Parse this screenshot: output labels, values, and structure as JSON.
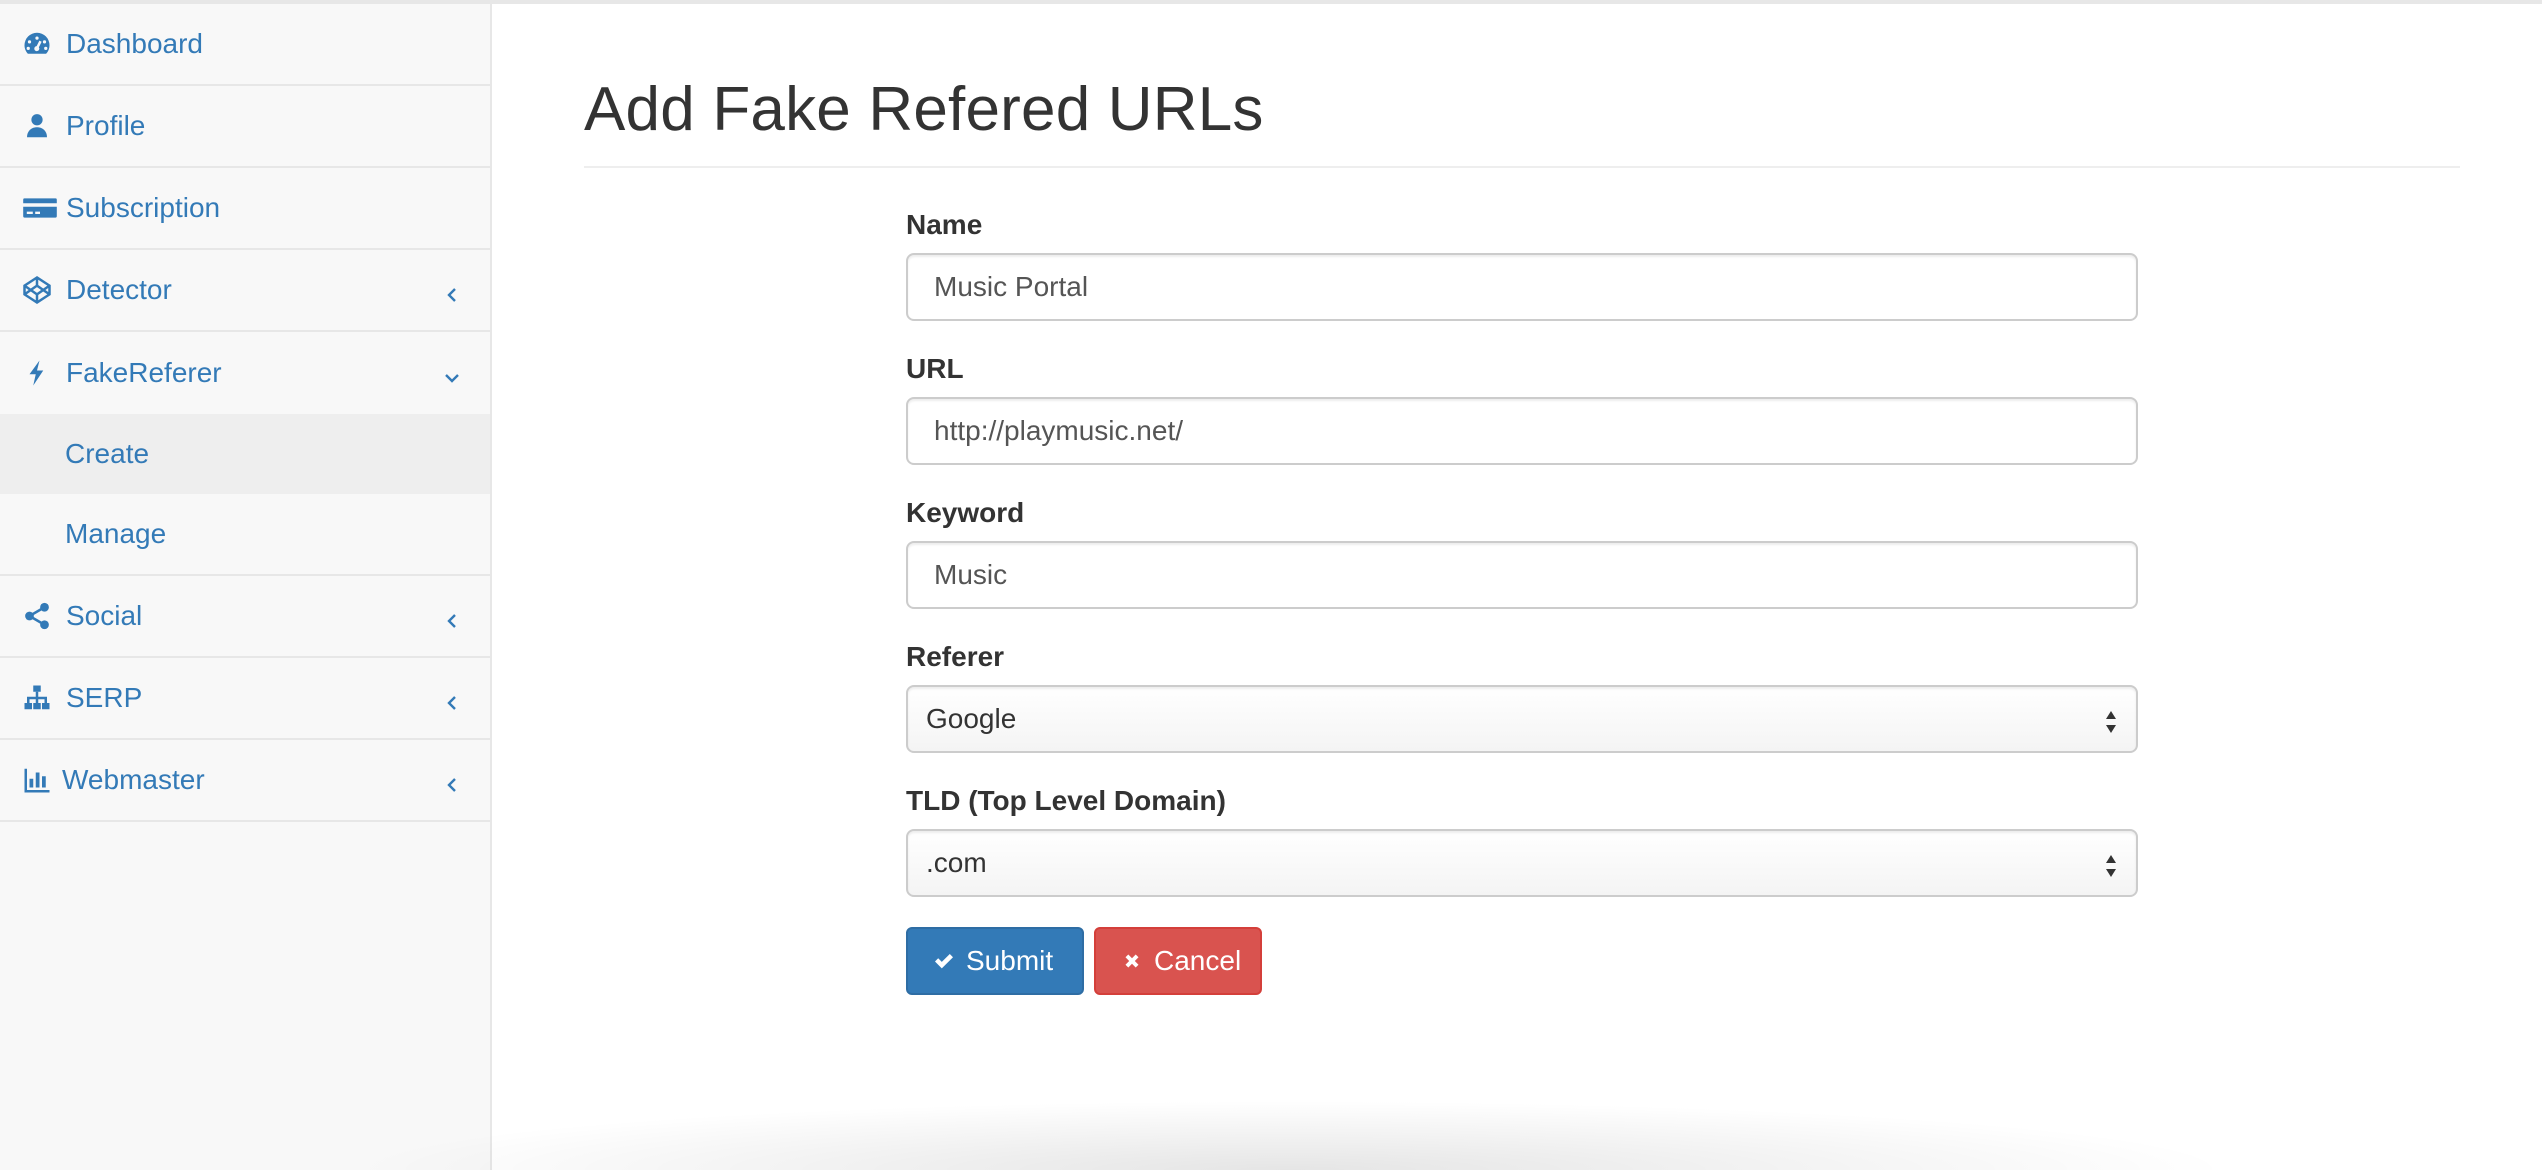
{
  "sidebar": {
    "items": [
      {
        "label": "Dashboard",
        "icon": "dashboard-icon"
      },
      {
        "label": "Profile",
        "icon": "user-icon"
      },
      {
        "label": "Subscription",
        "icon": "credit-card-icon"
      },
      {
        "label": "Detector",
        "icon": "codepen-icon",
        "chevron": "left"
      },
      {
        "label": "FakeReferer",
        "icon": "bolt-icon",
        "chevron": "down"
      }
    ],
    "subitems": [
      {
        "label": "Create",
        "active": true
      },
      {
        "label": "Manage",
        "active": false
      }
    ],
    "items_after": [
      {
        "label": "Social",
        "icon": "share-icon",
        "chevron": "left"
      },
      {
        "label": "SERP",
        "icon": "sitemap-icon",
        "chevron": "left"
      },
      {
        "label": "Webmaster",
        "icon": "bar-chart-icon",
        "chevron": "left"
      }
    ]
  },
  "main": {
    "title": "Add Fake Refered URLs",
    "form": {
      "name": {
        "label": "Name",
        "value": "Music Portal"
      },
      "url": {
        "label": "URL",
        "value": "http://playmusic.net/"
      },
      "keyword": {
        "label": "Keyword",
        "value": "Music"
      },
      "referer": {
        "label": "Referer",
        "selected": "Google"
      },
      "tld": {
        "label": "TLD (Top Level Domain)",
        "selected": ".com"
      }
    },
    "buttons": {
      "submit": "Submit",
      "cancel": "Cancel"
    }
  },
  "colors": {
    "link": "#337ab7",
    "primary": "#337ab7",
    "danger": "#d9534f",
    "sidebar_bg": "#f8f8f8"
  }
}
